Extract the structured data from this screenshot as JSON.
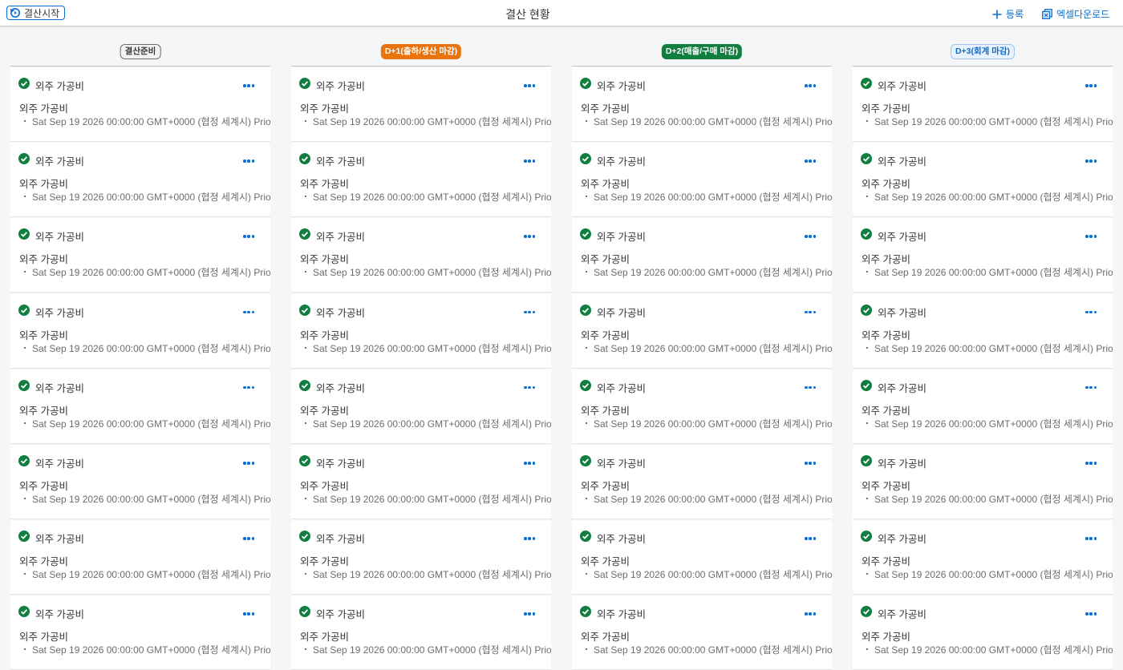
{
  "header": {
    "start_label": "결산시작",
    "title": "결산 현황",
    "register_label": "등록",
    "excel_label": "엑셀다운로드"
  },
  "columns": [
    {
      "tag": "결산준비",
      "cards": [
        {
          "title": "외주 가공비",
          "subtitle": "외주 가공비",
          "date": "Sat Sep 19 2026 00:00:00 GMT+0000 (협정 세계시) Prio"
        },
        {
          "title": "외주 가공비",
          "subtitle": "외주 가공비",
          "date": "Sat Sep 19 2026 00:00:00 GMT+0000 (협정 세계시) Prio"
        },
        {
          "title": "외주 가공비",
          "subtitle": "외주 가공비",
          "date": "Sat Sep 19 2026 00:00:00 GMT+0000 (협정 세계시) Prio"
        },
        {
          "title": "외주 가공비",
          "subtitle": "외주 가공비",
          "date": "Sat Sep 19 2026 00:00:00 GMT+0000 (협정 세계시) Prio"
        },
        {
          "title": "외주 가공비",
          "subtitle": "외주 가공비",
          "date": "Sat Sep 19 2026 00:00:00 GMT+0000 (협정 세계시) Prio"
        },
        {
          "title": "외주 가공비",
          "subtitle": "외주 가공비",
          "date": "Sat Sep 19 2026 00:00:00 GMT+0000 (협정 세계시) Prio"
        },
        {
          "title": "외주 가공비",
          "subtitle": "외주 가공비",
          "date": "Sat Sep 19 2026 00:00:00 GMT+0000 (협정 세계시) Prio"
        },
        {
          "title": "외주 가공비",
          "subtitle": "외주 가공비",
          "date": "Sat Sep 19 2026 00:00:00 GMT+0000 (협정 세계시) Prio"
        }
      ]
    },
    {
      "tag": "D+1(출하/생산 마감)",
      "cards": [
        {
          "title": "외주 가공비",
          "subtitle": "외주 가공비",
          "date": "Sat Sep 19 2026 00:00:00 GMT+0000 (협정 세계시) Prio"
        },
        {
          "title": "외주 가공비",
          "subtitle": "외주 가공비",
          "date": "Sat Sep 19 2026 00:00:00 GMT+0000 (협정 세계시) Prio"
        },
        {
          "title": "외주 가공비",
          "subtitle": "외주 가공비",
          "date": "Sat Sep 19 2026 00:00:00 GMT+0000 (협정 세계시) Prio"
        },
        {
          "title": "외주 가공비",
          "subtitle": "외주 가공비",
          "date": "Sat Sep 19 2026 00:00:00 GMT+0000 (협정 세계시) Prio"
        },
        {
          "title": "외주 가공비",
          "subtitle": "외주 가공비",
          "date": "Sat Sep 19 2026 00:00:00 GMT+0000 (협정 세계시) Prio"
        },
        {
          "title": "외주 가공비",
          "subtitle": "외주 가공비",
          "date": "Sat Sep 19 2026 00:00:00 GMT+0000 (협정 세계시) Prio"
        },
        {
          "title": "외주 가공비",
          "subtitle": "외주 가공비",
          "date": "Sat Sep 19 2026 00:00:00 GMT+0000 (협정 세계시) Prio"
        },
        {
          "title": "외주 가공비",
          "subtitle": "외주 가공비",
          "date": "Sat Sep 19 2026 00:00:00 GMT+0000 (협정 세계시) Prio"
        }
      ]
    },
    {
      "tag": "D+2(매출/구매 마감)",
      "cards": [
        {
          "title": "외주 가공비",
          "subtitle": "외주 가공비",
          "date": "Sat Sep 19 2026 00:00:00 GMT+0000 (협정 세계시) Prio"
        },
        {
          "title": "외주 가공비",
          "subtitle": "외주 가공비",
          "date": "Sat Sep 19 2026 00:00:00 GMT+0000 (협정 세계시) Prio"
        },
        {
          "title": "외주 가공비",
          "subtitle": "외주 가공비",
          "date": "Sat Sep 19 2026 00:00:00 GMT+0000 (협정 세계시) Prio"
        },
        {
          "title": "외주 가공비",
          "subtitle": "외주 가공비",
          "date": "Sat Sep 19 2026 00:00:00 GMT+0000 (협정 세계시) Prio"
        },
        {
          "title": "외주 가공비",
          "subtitle": "외주 가공비",
          "date": "Sat Sep 19 2026 00:00:00 GMT+0000 (협정 세계시) Prio"
        },
        {
          "title": "외주 가공비",
          "subtitle": "외주 가공비",
          "date": "Sat Sep 19 2026 00:00:00 GMT+0000 (협정 세계시) Prio"
        },
        {
          "title": "외주 가공비",
          "subtitle": "외주 가공비",
          "date": "Sat Sep 19 2026 00:00:00 GMT+0000 (협정 세계시) Prio"
        },
        {
          "title": "외주 가공비",
          "subtitle": "외주 가공비",
          "date": "Sat Sep 19 2026 00:00:00 GMT+0000 (협정 세계시) Prio"
        }
      ]
    },
    {
      "tag": "D+3(회계 마감)",
      "cards": [
        {
          "title": "외주 가공비",
          "subtitle": "외주 가공비",
          "date": "Sat Sep 19 2026 00:00:00 GMT+0000 (협정 세계시) Prio"
        },
        {
          "title": "외주 가공비",
          "subtitle": "외주 가공비",
          "date": "Sat Sep 19 2026 00:00:00 GMT+0000 (협정 세계시) Prio"
        },
        {
          "title": "외주 가공비",
          "subtitle": "외주 가공비",
          "date": "Sat Sep 19 2026 00:00:00 GMT+0000 (협정 세계시) Prio"
        },
        {
          "title": "외주 가공비",
          "subtitle": "외주 가공비",
          "date": "Sat Sep 19 2026 00:00:00 GMT+0000 (협정 세계시) Prio"
        },
        {
          "title": "외주 가공비",
          "subtitle": "외주 가공비",
          "date": "Sat Sep 19 2026 00:00:00 GMT+0000 (협정 세계시) Prio"
        },
        {
          "title": "외주 가공비",
          "subtitle": "외주 가공비",
          "date": "Sat Sep 19 2026 00:00:00 GMT+0000 (협정 세계시) Prio"
        },
        {
          "title": "외주 가공비",
          "subtitle": "외주 가공비",
          "date": "Sat Sep 19 2026 00:00:00 GMT+0000 (협정 세계시) Prio"
        },
        {
          "title": "외주 가공비",
          "subtitle": "외주 가공비",
          "date": "Sat Sep 19 2026 00:00:00 GMT+0000 (협정 세계시) Prio"
        }
      ]
    }
  ],
  "colors": {
    "accent": "#0a6ed1",
    "success": "#107e3e",
    "warning": "#e9730c"
  },
  "icons": {
    "start": "restart-icon",
    "register": "add-icon",
    "excel": "excel-download-icon",
    "status": "check-circle-icon",
    "menu": "more-icon"
  }
}
